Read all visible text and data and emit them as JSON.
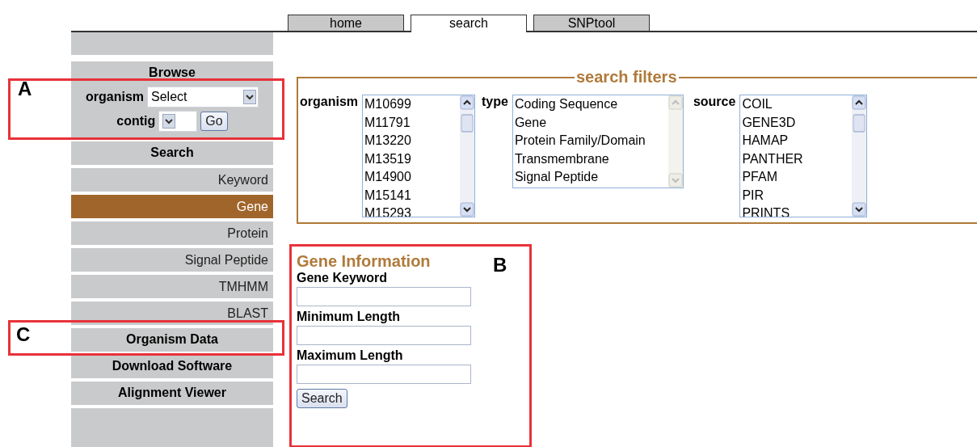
{
  "tabs": [
    {
      "label": "home",
      "selected": false
    },
    {
      "label": "search",
      "selected": true
    },
    {
      "label": "SNPtool",
      "selected": false
    }
  ],
  "sidebar": {
    "items": [
      {
        "kind": "heading",
        "label": "Browse"
      },
      {
        "kind": "browse",
        "organism_label": "organism",
        "organism_value": "Select",
        "contig_label": "contig",
        "go_button": "Go"
      },
      {
        "kind": "heading",
        "label": "Search"
      },
      {
        "kind": "link",
        "label": "Keyword",
        "selected": false
      },
      {
        "kind": "link",
        "label": "Gene",
        "selected": true
      },
      {
        "kind": "link",
        "label": "Protein",
        "selected": false
      },
      {
        "kind": "link",
        "label": "Signal Peptide",
        "selected": false
      },
      {
        "kind": "link",
        "label": "TMHMM",
        "selected": false
      },
      {
        "kind": "link",
        "label": "BLAST",
        "selected": false
      },
      {
        "kind": "heading",
        "label": "Organism Data"
      },
      {
        "kind": "heading",
        "label": "Download Software"
      },
      {
        "kind": "heading",
        "label": "Alignment Viewer"
      }
    ]
  },
  "search_filters": {
    "legend": "search filters",
    "lists": [
      {
        "label": "organism",
        "disabled_scroll": false,
        "options": [
          "M10699",
          "M11791",
          "M13220",
          "M13519",
          "M14900",
          "M15141",
          "M15293"
        ]
      },
      {
        "label": "type",
        "disabled_scroll": true,
        "options": [
          "Coding Sequence",
          "Gene",
          "Protein Family/Domain",
          "Transmembrane",
          "Signal Peptide"
        ]
      },
      {
        "label": "source",
        "disabled_scroll": false,
        "options": [
          "COIL",
          "GENE3D",
          "HAMAP",
          "PANTHER",
          "PFAM",
          "PIR",
          "PRINTS"
        ]
      }
    ]
  },
  "gene_information": {
    "title": "Gene Information",
    "fields": [
      {
        "label": "Gene Keyword"
      },
      {
        "label": "Minimum Length"
      },
      {
        "label": "Maximum Length"
      }
    ],
    "button": "Search"
  },
  "annotations": [
    {
      "label": "A"
    },
    {
      "label": "B"
    },
    {
      "label": "C"
    }
  ]
}
